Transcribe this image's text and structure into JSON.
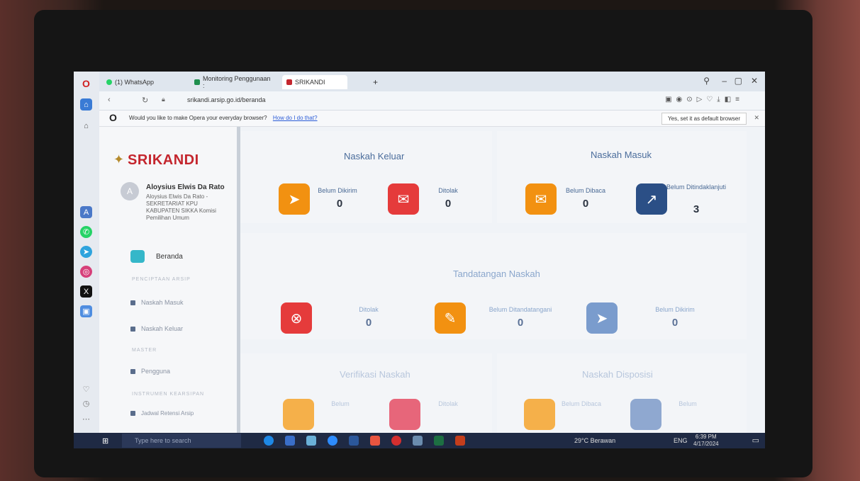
{
  "tabs": [
    {
      "label": "(1) WhatsApp"
    },
    {
      "label": "Monitoring Penggunaan :"
    },
    {
      "label": "SRIKANDI"
    }
  ],
  "address": {
    "url": "srikandi.arsip.go.id/beranda"
  },
  "prompt": {
    "text": "Would you like to make Opera your everyday browser?",
    "link": "How do I do that?",
    "button": "Yes, set it as default browser"
  },
  "sidebar": {
    "logo": "SRIKANDI",
    "avatar_initial": "A",
    "user_name": "Aloysius Elwis Da Rato",
    "user_info": "Aloysius Elwis Da Rato - SEKRETARIAT KPU KABUPATEN SIKKA Komisi Pemilihan Umum",
    "home": "Beranda",
    "sections": {
      "penciptaan": "PENCIPTAAN ARSIP",
      "master": "MASTER",
      "instrumen": "INSTRUMEN KEARSIPAN"
    },
    "items": {
      "masuk": "Naskah Masuk",
      "keluar": "Naskah Keluar",
      "pengguna": "Pengguna",
      "jadwal": "Jadwal Retensi Arsip"
    }
  },
  "panels": {
    "keluar": {
      "title": "Naskah Keluar",
      "cards": [
        {
          "label": "Belum Dikirim",
          "value": "0",
          "color": "#f29111",
          "icon": "send-icon"
        },
        {
          "label": "Ditolak",
          "value": "0",
          "color": "#e53b3b",
          "icon": "mail-reject-icon"
        }
      ]
    },
    "masuk": {
      "title": "Naskah Masuk",
      "cards": [
        {
          "label": "Belum Dibaca",
          "value": "0",
          "color": "#f29111",
          "icon": "mail-unread-icon"
        },
        {
          "label": "Belum Ditindaklanjuti",
          "value": "3",
          "color": "#2b4f86",
          "icon": "arrow-up-right-icon"
        }
      ]
    },
    "tandatangan": {
      "title": "Tandatangan Naskah",
      "cards": [
        {
          "label": "Ditolak",
          "value": "0",
          "color": "#e53b3b",
          "icon": "close-circle-icon"
        },
        {
          "label": "Belum Ditandatangani",
          "value": "0",
          "color": "#f29111",
          "icon": "pen-icon"
        },
        {
          "label": "Belum Dikirim",
          "value": "0",
          "color": "#7a9ccd",
          "icon": "send-icon"
        }
      ]
    },
    "verifikasi": {
      "title": "Verifikasi Naskah",
      "labels": [
        "Belum",
        "Ditolak"
      ]
    },
    "disposisi": {
      "title": "Naskah Disposisi",
      "labels": [
        "Belum Dibaca",
        "Belum"
      ]
    }
  },
  "taskbar": {
    "search": "Type here to search",
    "weather": "29°C Berawan",
    "lang": "ENG",
    "time": "6:39 PM",
    "date": "4/17/2024"
  }
}
